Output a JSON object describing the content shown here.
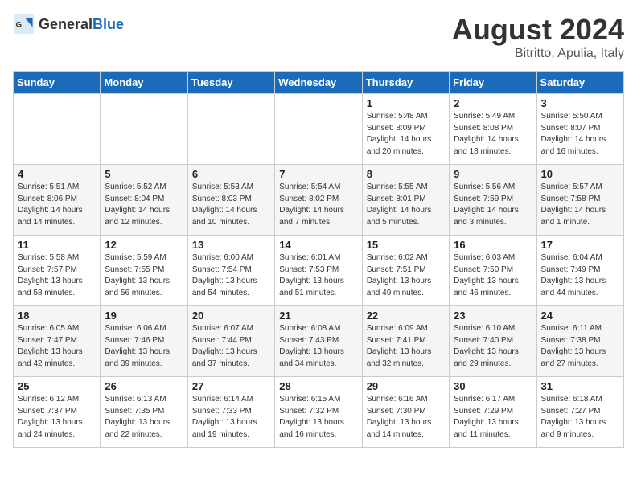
{
  "header": {
    "logo_general": "General",
    "logo_blue": "Blue",
    "month_year": "August 2024",
    "location": "Bitritto, Apulia, Italy"
  },
  "weekdays": [
    "Sunday",
    "Monday",
    "Tuesday",
    "Wednesday",
    "Thursday",
    "Friday",
    "Saturday"
  ],
  "weeks": [
    [
      {
        "day": "",
        "sunrise": "",
        "sunset": "",
        "daylight": ""
      },
      {
        "day": "",
        "sunrise": "",
        "sunset": "",
        "daylight": ""
      },
      {
        "day": "",
        "sunrise": "",
        "sunset": "",
        "daylight": ""
      },
      {
        "day": "",
        "sunrise": "",
        "sunset": "",
        "daylight": ""
      },
      {
        "day": "1",
        "sunrise": "Sunrise: 5:48 AM",
        "sunset": "Sunset: 8:09 PM",
        "daylight": "Daylight: 14 hours and 20 minutes."
      },
      {
        "day": "2",
        "sunrise": "Sunrise: 5:49 AM",
        "sunset": "Sunset: 8:08 PM",
        "daylight": "Daylight: 14 hours and 18 minutes."
      },
      {
        "day": "3",
        "sunrise": "Sunrise: 5:50 AM",
        "sunset": "Sunset: 8:07 PM",
        "daylight": "Daylight: 14 hours and 16 minutes."
      }
    ],
    [
      {
        "day": "4",
        "sunrise": "Sunrise: 5:51 AM",
        "sunset": "Sunset: 8:06 PM",
        "daylight": "Daylight: 14 hours and 14 minutes."
      },
      {
        "day": "5",
        "sunrise": "Sunrise: 5:52 AM",
        "sunset": "Sunset: 8:04 PM",
        "daylight": "Daylight: 14 hours and 12 minutes."
      },
      {
        "day": "6",
        "sunrise": "Sunrise: 5:53 AM",
        "sunset": "Sunset: 8:03 PM",
        "daylight": "Daylight: 14 hours and 10 minutes."
      },
      {
        "day": "7",
        "sunrise": "Sunrise: 5:54 AM",
        "sunset": "Sunset: 8:02 PM",
        "daylight": "Daylight: 14 hours and 7 minutes."
      },
      {
        "day": "8",
        "sunrise": "Sunrise: 5:55 AM",
        "sunset": "Sunset: 8:01 PM",
        "daylight": "Daylight: 14 hours and 5 minutes."
      },
      {
        "day": "9",
        "sunrise": "Sunrise: 5:56 AM",
        "sunset": "Sunset: 7:59 PM",
        "daylight": "Daylight: 14 hours and 3 minutes."
      },
      {
        "day": "10",
        "sunrise": "Sunrise: 5:57 AM",
        "sunset": "Sunset: 7:58 PM",
        "daylight": "Daylight: 14 hours and 1 minute."
      }
    ],
    [
      {
        "day": "11",
        "sunrise": "Sunrise: 5:58 AM",
        "sunset": "Sunset: 7:57 PM",
        "daylight": "Daylight: 13 hours and 58 minutes."
      },
      {
        "day": "12",
        "sunrise": "Sunrise: 5:59 AM",
        "sunset": "Sunset: 7:55 PM",
        "daylight": "Daylight: 13 hours and 56 minutes."
      },
      {
        "day": "13",
        "sunrise": "Sunrise: 6:00 AM",
        "sunset": "Sunset: 7:54 PM",
        "daylight": "Daylight: 13 hours and 54 minutes."
      },
      {
        "day": "14",
        "sunrise": "Sunrise: 6:01 AM",
        "sunset": "Sunset: 7:53 PM",
        "daylight": "Daylight: 13 hours and 51 minutes."
      },
      {
        "day": "15",
        "sunrise": "Sunrise: 6:02 AM",
        "sunset": "Sunset: 7:51 PM",
        "daylight": "Daylight: 13 hours and 49 minutes."
      },
      {
        "day": "16",
        "sunrise": "Sunrise: 6:03 AM",
        "sunset": "Sunset: 7:50 PM",
        "daylight": "Daylight: 13 hours and 46 minutes."
      },
      {
        "day": "17",
        "sunrise": "Sunrise: 6:04 AM",
        "sunset": "Sunset: 7:49 PM",
        "daylight": "Daylight: 13 hours and 44 minutes."
      }
    ],
    [
      {
        "day": "18",
        "sunrise": "Sunrise: 6:05 AM",
        "sunset": "Sunset: 7:47 PM",
        "daylight": "Daylight: 13 hours and 42 minutes."
      },
      {
        "day": "19",
        "sunrise": "Sunrise: 6:06 AM",
        "sunset": "Sunset: 7:46 PM",
        "daylight": "Daylight: 13 hours and 39 minutes."
      },
      {
        "day": "20",
        "sunrise": "Sunrise: 6:07 AM",
        "sunset": "Sunset: 7:44 PM",
        "daylight": "Daylight: 13 hours and 37 minutes."
      },
      {
        "day": "21",
        "sunrise": "Sunrise: 6:08 AM",
        "sunset": "Sunset: 7:43 PM",
        "daylight": "Daylight: 13 hours and 34 minutes."
      },
      {
        "day": "22",
        "sunrise": "Sunrise: 6:09 AM",
        "sunset": "Sunset: 7:41 PM",
        "daylight": "Daylight: 13 hours and 32 minutes."
      },
      {
        "day": "23",
        "sunrise": "Sunrise: 6:10 AM",
        "sunset": "Sunset: 7:40 PM",
        "daylight": "Daylight: 13 hours and 29 minutes."
      },
      {
        "day": "24",
        "sunrise": "Sunrise: 6:11 AM",
        "sunset": "Sunset: 7:38 PM",
        "daylight": "Daylight: 13 hours and 27 minutes."
      }
    ],
    [
      {
        "day": "25",
        "sunrise": "Sunrise: 6:12 AM",
        "sunset": "Sunset: 7:37 PM",
        "daylight": "Daylight: 13 hours and 24 minutes."
      },
      {
        "day": "26",
        "sunrise": "Sunrise: 6:13 AM",
        "sunset": "Sunset: 7:35 PM",
        "daylight": "Daylight: 13 hours and 22 minutes."
      },
      {
        "day": "27",
        "sunrise": "Sunrise: 6:14 AM",
        "sunset": "Sunset: 7:33 PM",
        "daylight": "Daylight: 13 hours and 19 minutes."
      },
      {
        "day": "28",
        "sunrise": "Sunrise: 6:15 AM",
        "sunset": "Sunset: 7:32 PM",
        "daylight": "Daylight: 13 hours and 16 minutes."
      },
      {
        "day": "29",
        "sunrise": "Sunrise: 6:16 AM",
        "sunset": "Sunset: 7:30 PM",
        "daylight": "Daylight: 13 hours and 14 minutes."
      },
      {
        "day": "30",
        "sunrise": "Sunrise: 6:17 AM",
        "sunset": "Sunset: 7:29 PM",
        "daylight": "Daylight: 13 hours and 11 minutes."
      },
      {
        "day": "31",
        "sunrise": "Sunrise: 6:18 AM",
        "sunset": "Sunset: 7:27 PM",
        "daylight": "Daylight: 13 hours and 9 minutes."
      }
    ]
  ]
}
